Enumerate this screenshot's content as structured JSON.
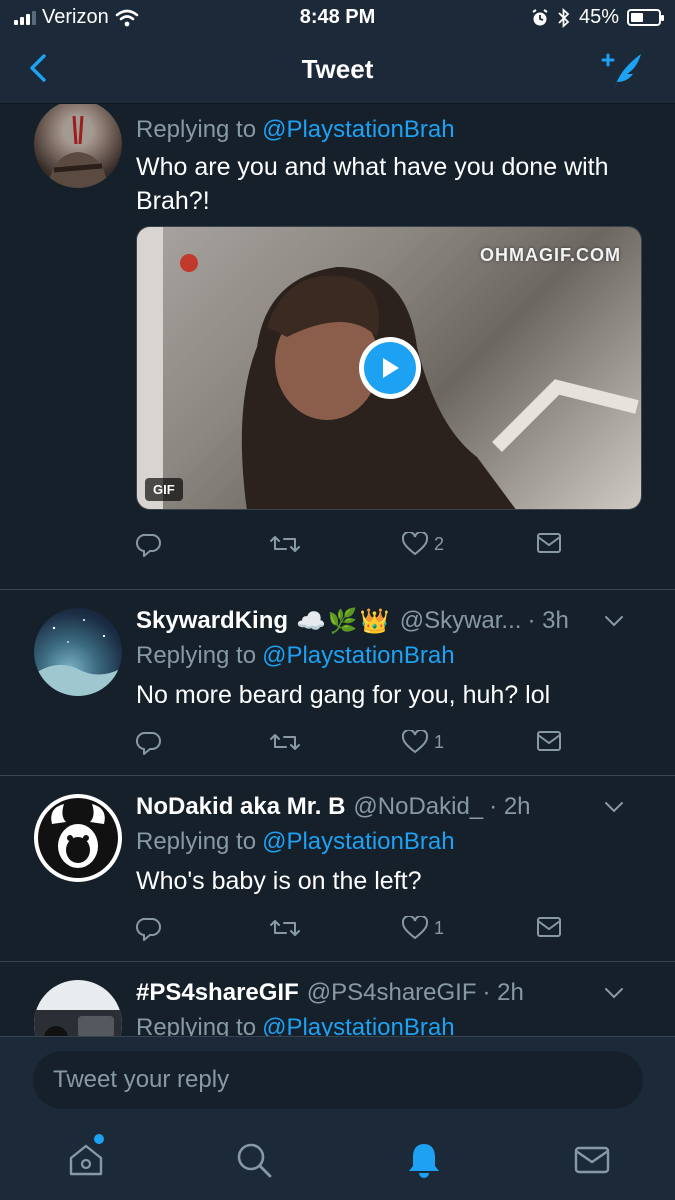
{
  "status_bar": {
    "carrier": "Verizon",
    "time": "8:48 PM",
    "battery": "45%",
    "battery_level": 0.45
  },
  "nav": {
    "title": "Tweet",
    "back_icon": "chevron-left-icon",
    "compose_icon": "compose-tweet-icon"
  },
  "tweets": [
    {
      "replying_label": "Replying to",
      "replying_to": "@PlaystationBrah",
      "text": "Who are you and what have you done with Brah?!",
      "media": {
        "watermark": "OHMAGIF.COM",
        "badge": "GIF"
      },
      "likes": "2"
    },
    {
      "name": "SkywardKing",
      "emoji": "☁️🌿👑",
      "handle": "@Skywar...",
      "time": "· 3h",
      "replying_label": "Replying to",
      "replying_to": "@PlaystationBrah",
      "text": "No more beard gang for you, huh? lol",
      "likes": "1"
    },
    {
      "name": "NoDakid aka Mr. B",
      "handle": "@NoDakid_",
      "time": "· 2h",
      "replying_label": "Replying to",
      "replying_to": "@PlaystationBrah",
      "text": "Who's baby is on the left?",
      "likes": "1"
    },
    {
      "name": "#PS4shareGIF",
      "handle": "@PS4shareGIF",
      "time": "· 2h",
      "replying_label": "Replying to",
      "replying_to": "@PlaystationBrah"
    }
  ],
  "reply": {
    "placeholder": "Tweet your reply"
  },
  "colors": {
    "background": "#15202b",
    "bar": "#1c2938",
    "accent": "#1da1f2",
    "muted": "#8899a6",
    "divider": "#38444d"
  },
  "tabs": [
    "home-icon",
    "search-icon",
    "notifications-icon",
    "messages-icon"
  ]
}
